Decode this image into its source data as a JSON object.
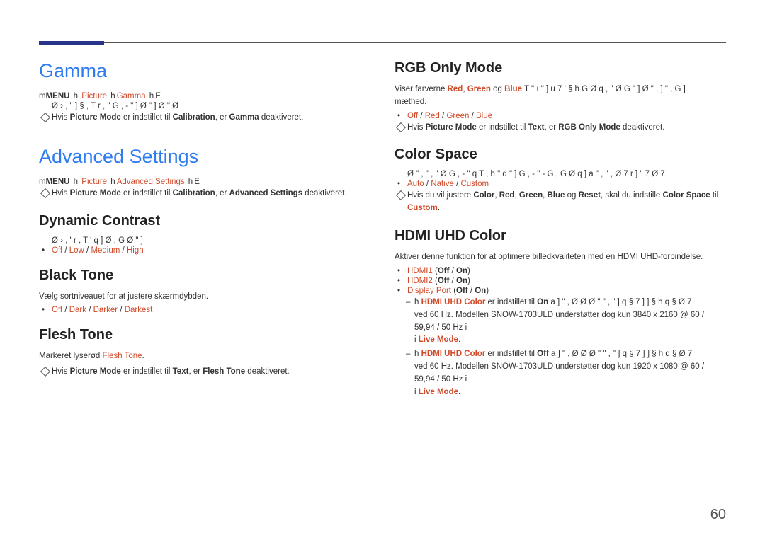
{
  "page_number": "60",
  "left": {
    "gamma": {
      "title": "Gamma",
      "nav_menu": "MENU",
      "nav_picture": "Picture",
      "nav_gamma": "Gamma",
      "nav_enter": "E",
      "enc_line": "Ø › ,    \" ]  § ,    T r ,  \"     G , - \"   ] Ø \" ]     Ø \" Ø",
      "note1_pre": "Hvis ",
      "note1_pm": "Picture Mode",
      "note1_mid": " er indstillet til ",
      "note1_cal": "Calibration",
      "note1_mid2": ", er ",
      "note1_g": "Gamma",
      "note1_post": " deaktiveret."
    },
    "adv": {
      "title": "Advanced Settings",
      "nav_menu": "MENU",
      "nav_picture": "Picture",
      "nav_adv": "Advanced Settings",
      "nav_enter": "E",
      "note1_pre": "Hvis ",
      "note1_pm": "Picture Mode",
      "note1_mid": " er indstillet til ",
      "note1_cal": "Calibration",
      "note1_mid2": ", er ",
      "note1_as": "Advanced Settings",
      "note1_post": " deaktiveret."
    },
    "dyn": {
      "title": "Dynamic Contrast",
      "enc_line": "Ø › ,     ' r , T ' q ] Ø , G   Ø \" ]",
      "opts_off": "Off",
      "opts_low": "Low",
      "opts_med": "Medium",
      "opts_high": "High"
    },
    "black": {
      "title": "Black Tone",
      "desc": "Vælg sortniveauet for at justere skærmdybden.",
      "opts_off": "Off",
      "opts_dark": "Dark",
      "opts_darker": "Darker",
      "opts_darkest": "Darkest"
    },
    "flesh": {
      "title": "Flesh Tone",
      "desc_pre": "Markeret lyserød ",
      "desc_ft": "Flesh Tone",
      "desc_post": ".",
      "note_pre": "Hvis ",
      "note_pm": "Picture Mode",
      "note_mid": " er indstillet til ",
      "note_text": "Text",
      "note_mid2": ", er ",
      "note_ft": "Flesh Tone",
      "note_post": " deaktiveret."
    }
  },
  "right": {
    "rgb": {
      "title": "RGB Only Mode",
      "desc_pre": "Viser farverne ",
      "desc_red": "Red",
      "desc_green": "Green",
      "desc_blue": "Blue",
      "desc_og1": " og ",
      "desc_sep": ", ",
      "desc_enc": " T \"   ı \" ] u 7   '   § h   G Ø   q , \" Ø G   \"     ]    Ø \" ,   ]   \" ,   G    ]",
      "desc_post2": "mæthed.",
      "opts_off": "Off",
      "opts_red": "Red",
      "opts_green": "Green",
      "opts_blue": "Blue",
      "note_pre": "Hvis ",
      "note_pm": "Picture Mode",
      "note_mid": " er indstillet til ",
      "note_text": "Text",
      "note_mid2": ", er ",
      "note_rgb": "RGB Only Mode",
      "note_post": " deaktiveret."
    },
    "cs": {
      "title": "Color Space",
      "enc_line": "Ø \" , \" ,    \" Ø    G , - \" q T , h   \"   q    \" ]    G , - \" - G ,   G Ø   q ] a    \" ,   \" ,   Ø   7   r ]   \" 7     Ø   7",
      "opts_auto": "Auto",
      "opts_native": "Native",
      "opts_custom": "Custom",
      "note_pre": "Hvis du vil justere ",
      "note_color": "Color",
      "note_red": "Red",
      "note_green": "Green",
      "note_blue": "Blue",
      "note_reset": "Reset",
      "note_og": " og ",
      "note_sep": ", ",
      "note_mid": ", skal du indstille ",
      "note_cs": "Color Space",
      "note_til": " til ",
      "note_custom": "Custom",
      "note_post": "."
    },
    "hdmi": {
      "title": "HDMI UHD Color",
      "desc": "Aktiver denne funktion for at optimere billedkvaliteten med en HDMI UHD-forbindelse.",
      "opt1_name": "HDMI1",
      "opt2_name": "HDMI2",
      "opt3_name": "Display Port",
      "opt_lp": " (",
      "opt_off": "Off",
      "opt_slash": " / ",
      "opt_on": "On",
      "opt_rp": ")",
      "d1_pre": "h  ",
      "d1_huc": "HDMI UHD Color",
      "d1_mid": " er indstillet til ",
      "d1_on": "On",
      "d1_enc": " a     ]   \" ,    Ø   Ø Ø \"       \" ,  \" ]   q § 7    ]   ]     § h   q §   Ø   7",
      "d1_line2": "ved 60 Hz. Modellen SNOW-1703ULD understøtter dog kun 3840 x 2160 @ 60 / 59,94 / 50 Hz i ",
      "d1_live": "Live Mode",
      "d2_off": "Off",
      "d2_line2": "ved 60 Hz. Modellen SNOW-1703ULD understøtter dog kun 1920 x 1080 @ 60 / 59,94 / 50 Hz i ",
      "period": "."
    }
  }
}
